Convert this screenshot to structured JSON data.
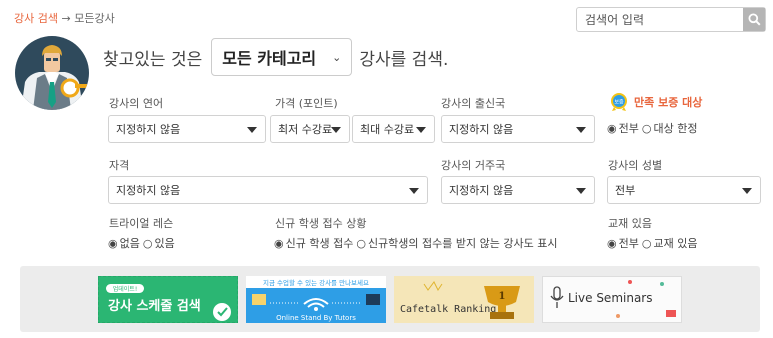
{
  "breadcrumb": {
    "link": "강사 검색",
    "separator": "→",
    "current": "모든강사"
  },
  "search": {
    "placeholder": "검색어 입력",
    "icon": "search-icon"
  },
  "headline": {
    "prefix": "찾고있는 것은",
    "category": "모든 카테고리",
    "suffix": "강사를 검색."
  },
  "filters": {
    "language": {
      "label": "강사의 연어",
      "value": "지정하지 않음"
    },
    "price": {
      "label": "가격 (포인트)",
      "min": "최저 수강료",
      "max": "최대 수강료"
    },
    "origin": {
      "label": "강사의 출신국",
      "value": "지정하지 않음"
    },
    "guarantee": {
      "label": "만족 보증 대상",
      "badge": "보증",
      "options": [
        "전부",
        "대상 한정"
      ],
      "selected": 0
    },
    "qualification": {
      "label": "자격",
      "value": "지정하지 않음"
    },
    "residence": {
      "label": "강사의 거주국",
      "value": "지정하지 않음"
    },
    "gender": {
      "label": "강사의 성별",
      "value": "전부"
    },
    "trial": {
      "label": "트라이얼 레슨",
      "options": [
        "없음",
        "있음"
      ],
      "selected": 0
    },
    "new_students": {
      "label": "신규 학생 접수 상황",
      "options": [
        "신규 학생 접수",
        "신규학생의 접수를 받지 않는 강사도 표시"
      ],
      "selected": 0
    },
    "materials": {
      "label": "교재 있음",
      "options": [
        "전부",
        "교재 있음"
      ],
      "selected": 0
    }
  },
  "banners": {
    "schedule": {
      "tag": "업데이트!",
      "title": "강사 스케줄 검색"
    },
    "standby": {
      "title": "지금 수업할 수 있는 강사를 만나보세요",
      "subtitle": "Online Stand By Tutors"
    },
    "ranking": {
      "title": "Cafetalk Ranking"
    },
    "seminars": {
      "title": "Live Seminars"
    }
  },
  "colors": {
    "accent": "#e8663d",
    "panel": "#ececec",
    "green": "#2bb673",
    "blue": "#2e9ee6"
  }
}
